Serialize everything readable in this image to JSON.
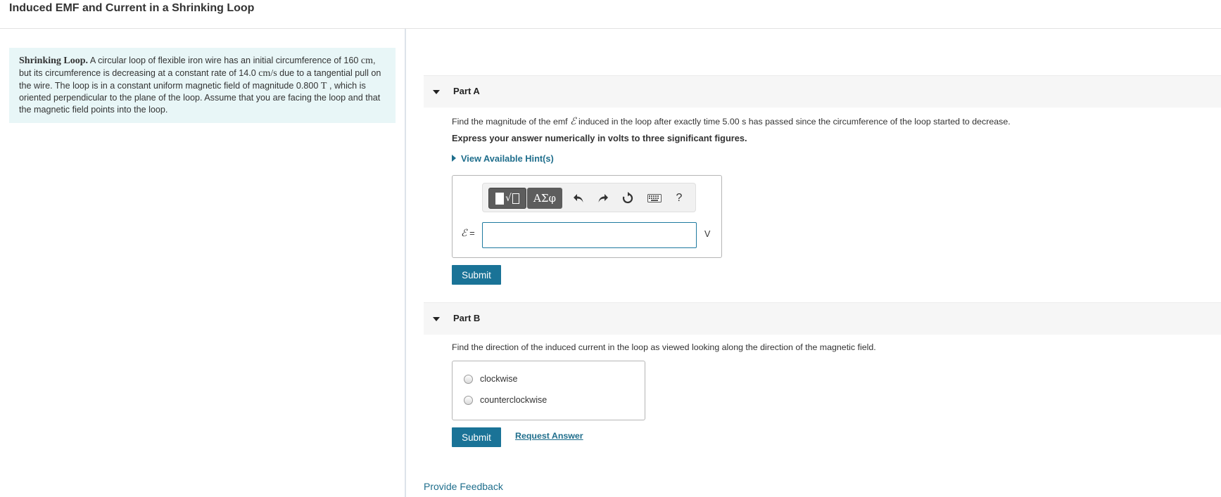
{
  "page_title": "Induced EMF and Current in a Shrinking Loop",
  "problem": {
    "lead": "Shrinking Loop.",
    "text_1": " A circular loop of flexible iron wire has an initial circumference of 160 ",
    "unit_1": "cm",
    "text_2": ", but its circumference is decreasing at a constant rate of 14.0 ",
    "unit_2": "cm/s",
    "text_3": " due to a tangential pull on the wire. The loop is in a constant uniform magnetic field of magnitude 0.800 ",
    "unit_3": "T",
    "text_4": " , which is oriented perpendicular to the plane of the loop. Assume that you are facing the loop and that the magnetic field points into the loop."
  },
  "part_a": {
    "label": "Part A",
    "question_pre": "Find the magnitude of the emf ",
    "emf_symbol": "ℰ",
    "question_post": " induced in the loop after exactly time 5.00 s has passed since the circumference of the loop started to decrease.",
    "instruction": "Express your answer numerically in volts to three significant figures.",
    "hints_label": "View Available Hint(s)",
    "toolbar": {
      "templates_radical": "√",
      "greek_label": "ΑΣφ",
      "help_label": "?"
    },
    "input_label_symbol": "ℰ",
    "input_label_eq": " =",
    "input_value": "",
    "unit": "V",
    "submit_label": "Submit"
  },
  "part_b": {
    "label": "Part B",
    "question": "Find the direction of the induced current in the loop as viewed looking along the direction of the magnetic field.",
    "options": [
      "clockwise",
      "counterclockwise"
    ],
    "submit_label": "Submit",
    "request_answer_label": "Request Answer"
  },
  "feedback_label": "Provide Feedback"
}
